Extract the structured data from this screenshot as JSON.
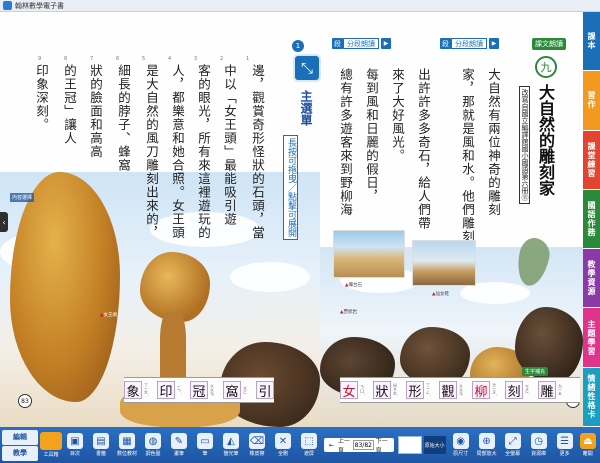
{
  "window": {
    "title": "翰林數學電子書"
  },
  "left_page": {
    "page_number": "83",
    "photo_tag": "內容選擇",
    "columns": [
      [
        "印",
        "象",
        "深",
        "刻",
        "。"
      ],
      [
        "的",
        "王",
        "冠",
        "」",
        "讓",
        "人"
      ],
      [
        "狀",
        "的",
        "臉",
        "面",
        "和",
        "高",
        "高"
      ],
      [
        "細",
        "長",
        "的",
        "脖",
        "子",
        "、",
        "蜂",
        "窩"
      ],
      [
        "是",
        "大",
        "自",
        "然",
        "的",
        "風",
        "刀",
        "雕",
        "刻",
        "出",
        "來",
        "的",
        "，"
      ],
      [
        "人",
        "，",
        "都",
        "樂",
        "意",
        "和",
        "她",
        "合",
        "照",
        "。",
        "女",
        "王",
        "頭"
      ],
      [
        "客",
        "的",
        "眼",
        "光",
        "，",
        "所",
        "有",
        "來",
        "這",
        "裡",
        "遊",
        "玩",
        "的"
      ],
      [
        "中",
        "以",
        "「",
        "女",
        "王",
        "頭",
        "」",
        "最",
        "能",
        "吸",
        "引",
        "遊"
      ],
      [
        "邊",
        "，",
        "觀",
        "賞",
        "奇",
        "形",
        "怪",
        "狀",
        "的",
        "石",
        "頭",
        "，",
        "當"
      ]
    ],
    "photo_caption": "女王頭",
    "ruler_marks": [
      "9",
      "8",
      "7",
      "6",
      "5",
      "4",
      "3",
      "2",
      "1"
    ]
  },
  "main_menu": {
    "label": "主選單",
    "hint": "長按可拖曳／點擊可展開",
    "badge": "1"
  },
  "right_page": {
    "page_number": "82",
    "lesson_read_label": "課文朗讀",
    "lesson_number": "九",
    "lesson_title": "大自然的雕刻家",
    "lesson_subtitle": "改寫自國立編譯館國小國語第六冊⑪",
    "section_tags": [
      {
        "dan": "段",
        "read": "分段朗讀"
      },
      {
        "dan": "段",
        "read": "分段朗讀"
      }
    ],
    "columns": [
      [
        "大",
        "自",
        "然",
        "有",
        "兩",
        "位",
        "神",
        "奇",
        "的",
        "雕",
        "刻"
      ],
      [
        "家",
        "，",
        "那",
        "就",
        "是",
        "風",
        "和",
        "水",
        "。",
        "他",
        "們",
        "雕",
        "刻"
      ],
      [
        "出",
        "許",
        "許",
        "多",
        "多",
        "奇",
        "石",
        "，",
        "給",
        "人",
        "們",
        "帶"
      ],
      [
        "來",
        "了",
        "大",
        "好",
        "風",
        "光",
        "。"
      ],
      [
        "每",
        "到",
        "風",
        "和",
        "日",
        "麗",
        "的",
        "假",
        "日",
        "，"
      ],
      [
        "總",
        "有",
        "許",
        "多",
        "遊",
        "客",
        "來",
        "到",
        "野",
        "柳",
        "海"
      ]
    ],
    "photo_captions": [
      "燭台石",
      "蕈狀岩",
      "仙女鞋"
    ],
    "learn_tag": "生字補充"
  },
  "vocab_left": [
    {
      "ch": "象",
      "zy": "ㄒㄧㄤˋ"
    },
    {
      "ch": "印",
      "zy": "ㄧㄣˋ"
    },
    {
      "ch": "冠",
      "zy": "ㄍㄨㄢ"
    },
    {
      "ch": "窩",
      "zy": "ㄨㄛ"
    },
    {
      "ch": "引",
      "zy": "ㄧㄣˇ"
    }
  ],
  "vocab_right": [
    {
      "ch": "女",
      "zy": "ㄋㄩˇ"
    },
    {
      "ch": "狀",
      "zy": "ㄓㄨㄤˋ"
    },
    {
      "ch": "形",
      "zy": "ㄒㄧㄥˊ"
    },
    {
      "ch": "觀",
      "zy": "ㄍㄨㄢ"
    },
    {
      "ch": "柳",
      "zy": "ㄌㄧㄡˇ"
    },
    {
      "ch": "刻",
      "zy": "ㄎㄜˋ"
    },
    {
      "ch": "雕",
      "zy": "ㄉㄧㄠ"
    }
  ],
  "side_tabs": [
    {
      "label": "課本",
      "color": "#1b6fb7"
    },
    {
      "label": "習作",
      "color": "#f29a1f"
    },
    {
      "label": "課堂練習",
      "color": "#e2442f"
    },
    {
      "label": "國語作務",
      "color": "#2a8a3a"
    },
    {
      "label": "教學資源",
      "color": "#8a3aa6"
    },
    {
      "label": "主題學習",
      "color": "#e0338a"
    },
    {
      "label": "情緒性格卡",
      "color": "#1b9ec0"
    }
  ],
  "toolbar": {
    "left_top": "編輯",
    "left_bottom": "教學",
    "toolbox": "工具箱",
    "tools": [
      {
        "icon": "▣",
        "label": "目次"
      },
      {
        "icon": "▤",
        "label": "書籤"
      },
      {
        "icon": "▦",
        "label": "數位教材"
      },
      {
        "icon": "◍",
        "label": "調色盤"
      },
      {
        "icon": "✎",
        "label": "畫筆"
      },
      {
        "icon": "▭",
        "label": "筆"
      },
      {
        "icon": "◭",
        "label": "螢光筆"
      },
      {
        "icon": "⌫",
        "label": "橡皮擦"
      },
      {
        "icon": "✕",
        "label": "全刪"
      },
      {
        "icon": "⬚",
        "label": "遮屏"
      }
    ],
    "pager": {
      "prev": "上一頁",
      "current": "83/82",
      "next": "下一頁",
      "home": "首頁"
    },
    "fit_label": "原始大小",
    "right_tools": [
      {
        "icon": "◉",
        "label": "原尺寸"
      },
      {
        "icon": "⊕",
        "label": "局部放大"
      },
      {
        "icon": "⤢",
        "label": "全螢幕"
      },
      {
        "icon": "◷",
        "label": "資源庫"
      },
      {
        "icon": "☰",
        "label": "更多"
      }
    ],
    "exit_label": "離開"
  }
}
